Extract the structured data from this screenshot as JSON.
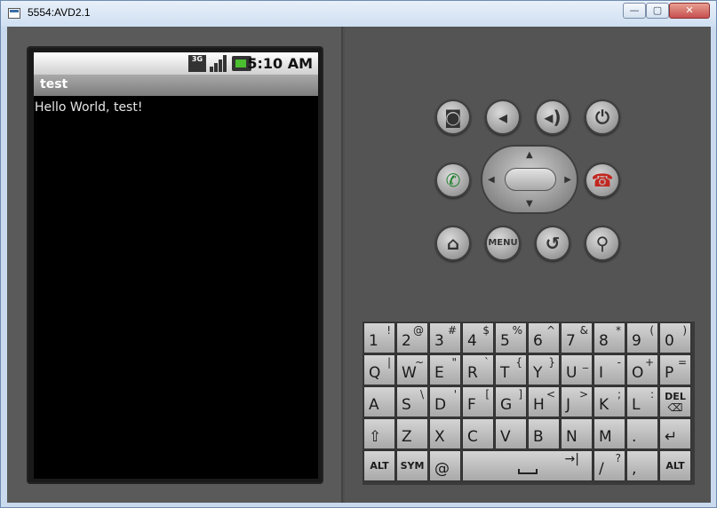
{
  "window": {
    "title": "5554:AVD2.1",
    "min_label": "—",
    "max_label": "▢",
    "close_label": "✕"
  },
  "phone": {
    "status": {
      "network_label": "3G",
      "time": "5:10 AM"
    },
    "app_title": "test",
    "content_text": "Hello World, test!"
  },
  "controls": {
    "menu_label": "MENU",
    "icons": [
      "camera-icon",
      "volume-down-icon",
      "volume-up-icon",
      "power-icon",
      "call-icon",
      "end-call-icon",
      "home-icon",
      "back-icon",
      "search-icon"
    ]
  },
  "keyboard": {
    "rows": [
      [
        {
          "main": "1",
          "alt": "!"
        },
        {
          "main": "2",
          "alt": "@"
        },
        {
          "main": "3",
          "alt": "#"
        },
        {
          "main": "4",
          "alt": "$"
        },
        {
          "main": "5",
          "alt": "%"
        },
        {
          "main": "6",
          "alt": "^"
        },
        {
          "main": "7",
          "alt": "&"
        },
        {
          "main": "8",
          "alt": "*"
        },
        {
          "main": "9",
          "alt": "("
        },
        {
          "main": "0",
          "alt": ")"
        }
      ],
      [
        {
          "main": "Q",
          "alt": "|"
        },
        {
          "main": "W",
          "alt": "~"
        },
        {
          "main": "E",
          "alt": "\""
        },
        {
          "main": "R",
          "alt": "`"
        },
        {
          "main": "T",
          "alt": "{"
        },
        {
          "main": "Y",
          "alt": "}"
        },
        {
          "main": "U",
          "alt": "_"
        },
        {
          "main": "I",
          "alt": "-"
        },
        {
          "main": "O",
          "alt": "+"
        },
        {
          "main": "P",
          "alt": "="
        }
      ],
      [
        {
          "main": "A",
          "alt": ""
        },
        {
          "main": "S",
          "alt": "\\"
        },
        {
          "main": "D",
          "alt": "'"
        },
        {
          "main": "F",
          "alt": "["
        },
        {
          "main": "G",
          "alt": "]"
        },
        {
          "main": "H",
          "alt": "<"
        },
        {
          "main": "J",
          "alt": ">"
        },
        {
          "main": "K",
          "alt": ";"
        },
        {
          "main": "L",
          "alt": ":"
        },
        {
          "main": "",
          "alt": "",
          "label": "DEL"
        }
      ],
      [
        {
          "main": "⇧",
          "alt": ""
        },
        {
          "main": "Z",
          "alt": ""
        },
        {
          "main": "X",
          "alt": ""
        },
        {
          "main": "C",
          "alt": ""
        },
        {
          "main": "V",
          "alt": ""
        },
        {
          "main": "B",
          "alt": ""
        },
        {
          "main": "N",
          "alt": ""
        },
        {
          "main": "M",
          "alt": ""
        },
        {
          "main": ".",
          "alt": ""
        },
        {
          "main": "↵",
          "alt": ""
        }
      ]
    ],
    "bottom": {
      "alt_left": "ALT",
      "sym": "SYM",
      "at": "@",
      "slash": "/",
      "slash_alt": "?",
      "comma": ",",
      "alt_right": "ALT",
      "tab_glyph": "→|"
    }
  }
}
